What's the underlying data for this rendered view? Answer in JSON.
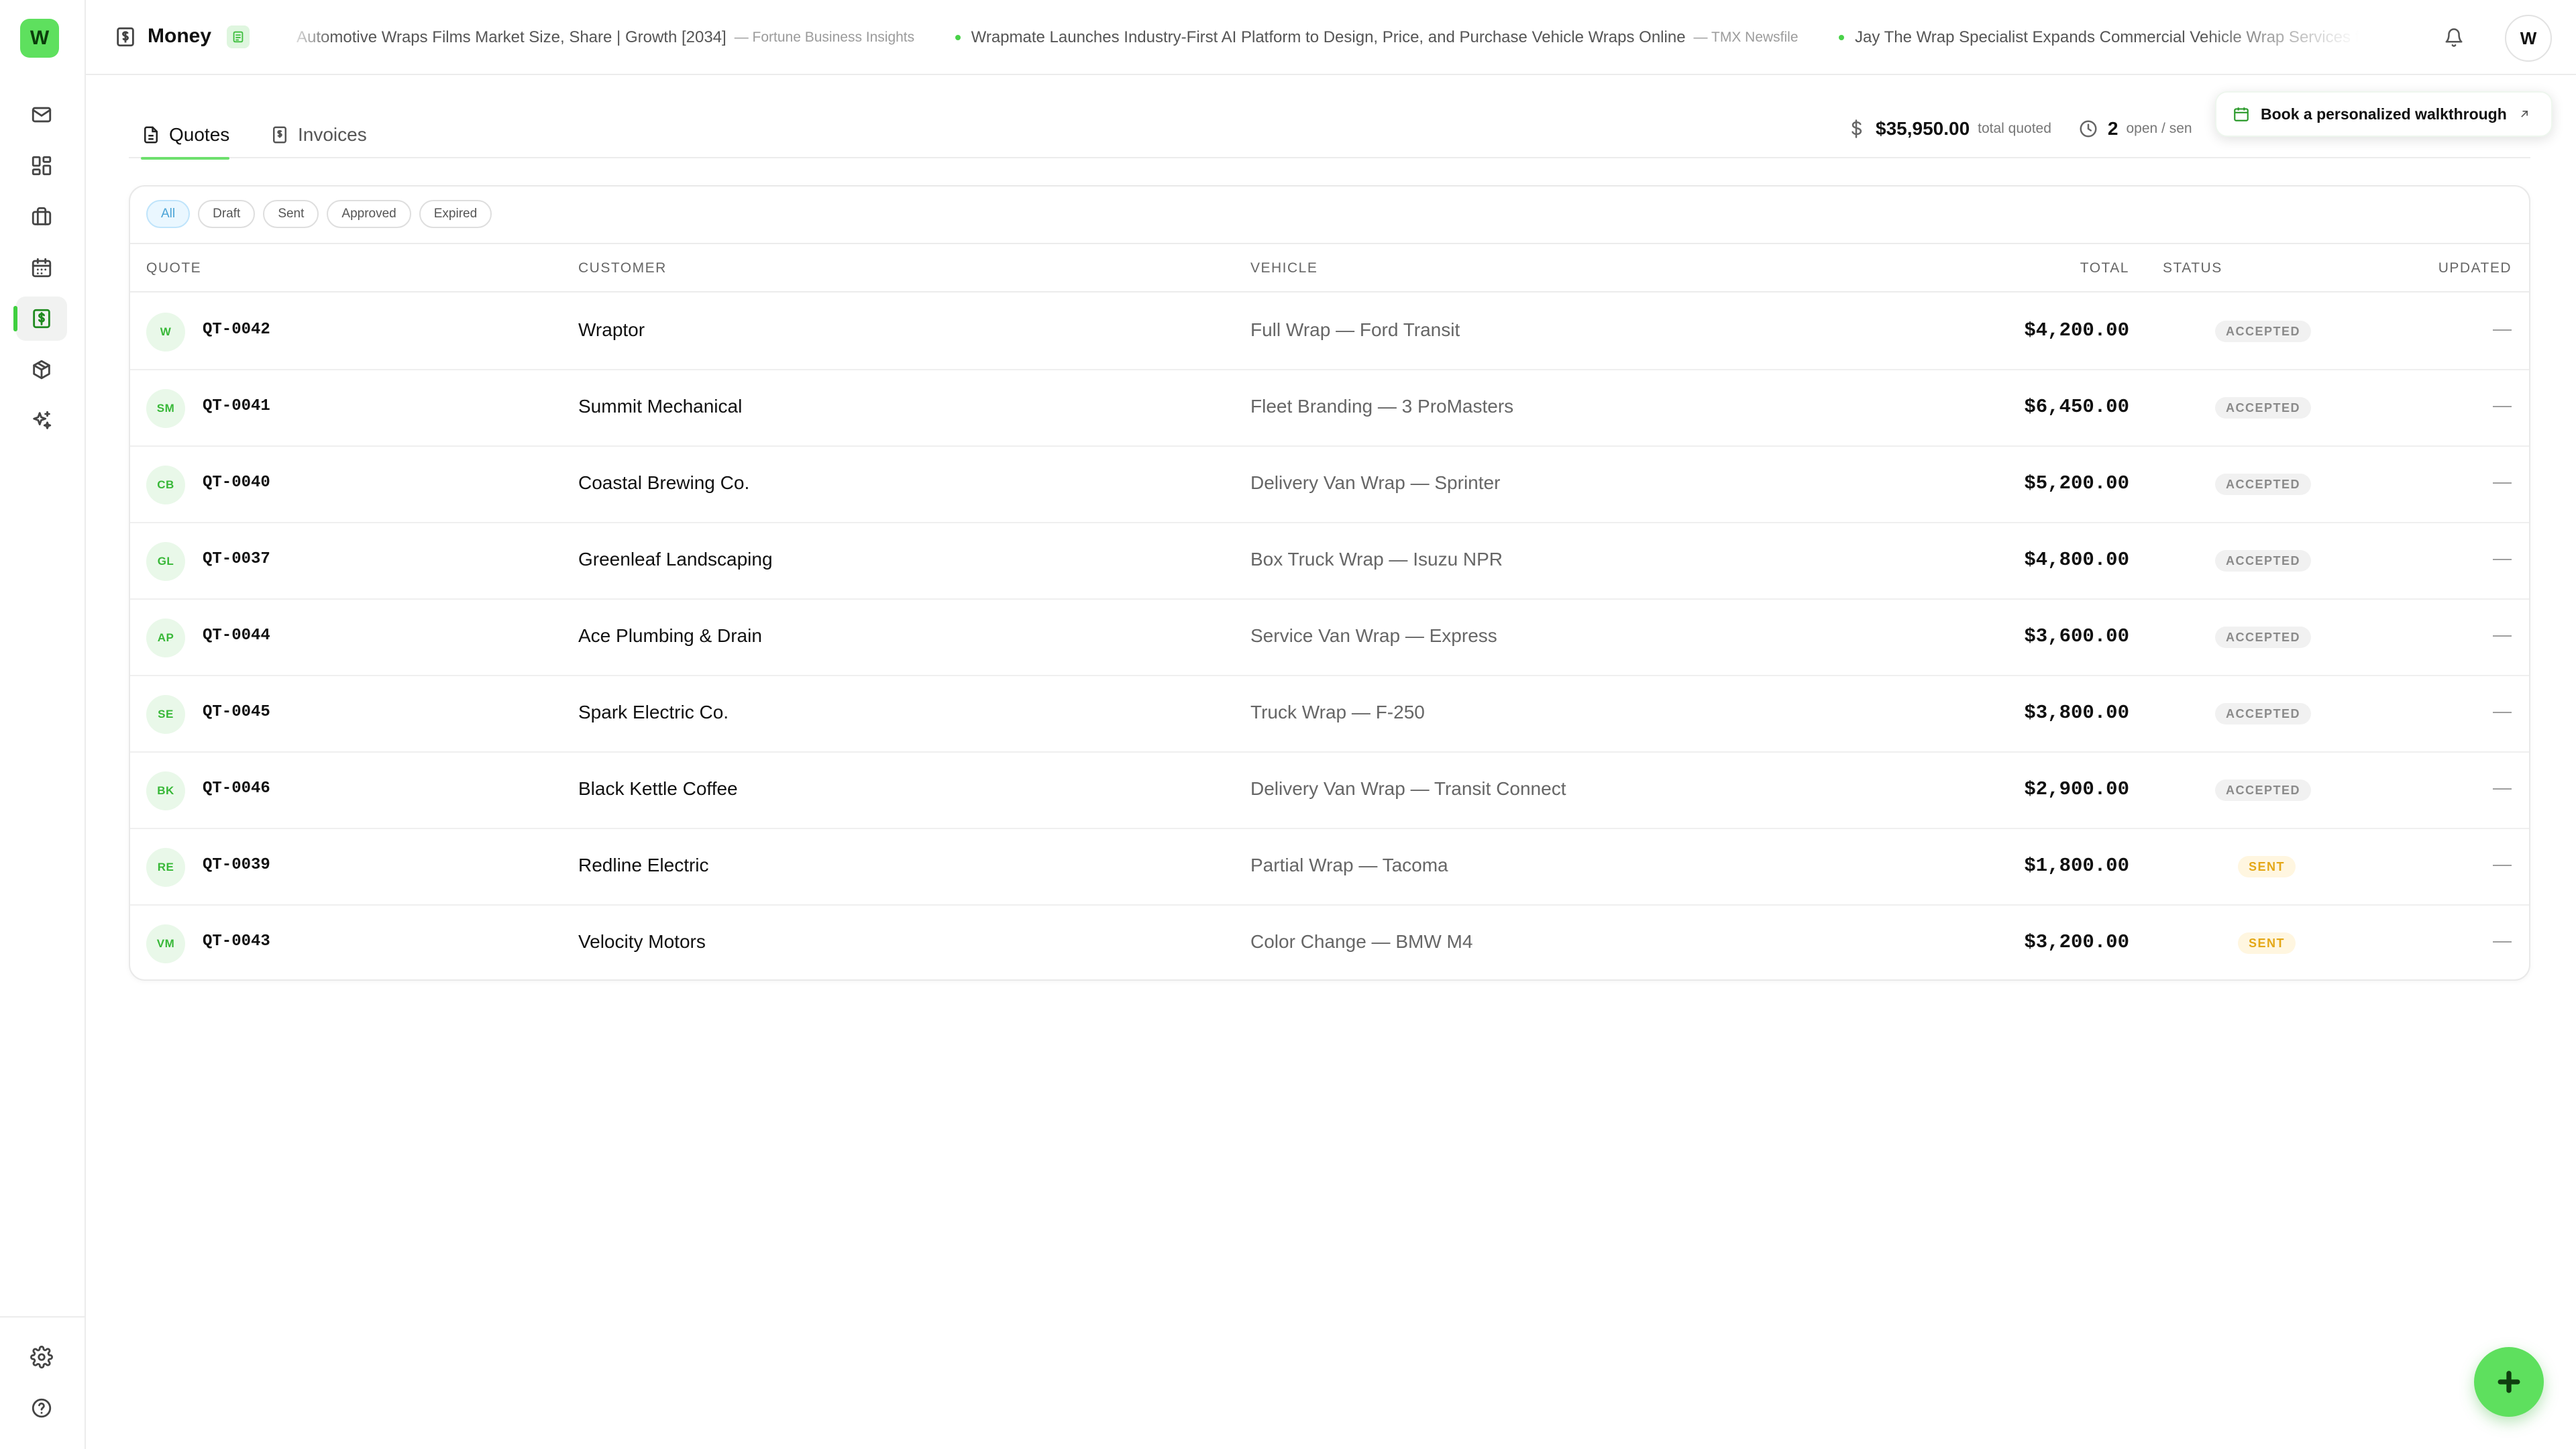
{
  "app": {
    "logo_letter": "W",
    "page_title": "Money",
    "user_initial": "W"
  },
  "sidebar": {
    "items": [
      {
        "name": "inbox",
        "icon": "mail-icon",
        "active": false
      },
      {
        "name": "dashboard",
        "icon": "dashboard-icon",
        "active": false
      },
      {
        "name": "jobs",
        "icon": "briefcase-icon",
        "active": false
      },
      {
        "name": "calendar",
        "icon": "calendar-icon",
        "active": false
      },
      {
        "name": "money",
        "icon": "money-icon",
        "active": true
      },
      {
        "name": "inventory",
        "icon": "package-icon",
        "active": false
      },
      {
        "name": "ai",
        "icon": "sparkles-icon",
        "active": false
      }
    ],
    "bottom": [
      {
        "name": "settings",
        "icon": "gear-icon"
      },
      {
        "name": "help",
        "icon": "help-icon"
      }
    ]
  },
  "news": [
    {
      "title": "Automotive Wraps Films Market Size, Share | Growth [2034]",
      "source": "— Fortune Business Insights"
    },
    {
      "title": "Wrapmate Launches Industry-First AI Platform to Design, Price, and Purchase Vehicle Wraps Online",
      "source": "— TMX Newsfile"
    },
    {
      "title": "Jay The Wrap Specialist Expands Commercial Vehicle Wrap Services for Mo",
      "source": ""
    }
  ],
  "tabs": [
    {
      "label": "Quotes",
      "active": true
    },
    {
      "label": "Invoices",
      "active": false
    }
  ],
  "stats": {
    "total_value": "$35,950.00",
    "total_label": "total quoted",
    "open_value": "2",
    "open_label": "open / sen"
  },
  "walkthrough": {
    "label": "Book a personalized walkthrough"
  },
  "filters": [
    "All",
    "Draft",
    "Sent",
    "Approved",
    "Expired"
  ],
  "table": {
    "columns": {
      "quote": "Quote",
      "customer": "Customer",
      "vehicle": "Vehicle",
      "total": "Total",
      "status": "Status",
      "updated": "Updated"
    },
    "rows": [
      {
        "initials": "W",
        "id": "QT-0042",
        "customer": "Wraptor",
        "vehicle": "Full Wrap — Ford Transit",
        "total": "$4,200.00",
        "status": "Accepted",
        "status_kind": "accepted",
        "updated": "—"
      },
      {
        "initials": "SM",
        "id": "QT-0041",
        "customer": "Summit Mechanical",
        "vehicle": "Fleet Branding — 3 ProMasters",
        "total": "$6,450.00",
        "status": "Accepted",
        "status_kind": "accepted",
        "updated": "—"
      },
      {
        "initials": "CB",
        "id": "QT-0040",
        "customer": "Coastal Brewing Co.",
        "vehicle": "Delivery Van Wrap — Sprinter",
        "total": "$5,200.00",
        "status": "Accepted",
        "status_kind": "accepted",
        "updated": "—"
      },
      {
        "initials": "GL",
        "id": "QT-0037",
        "customer": "Greenleaf Landscaping",
        "vehicle": "Box Truck Wrap — Isuzu NPR",
        "total": "$4,800.00",
        "status": "Accepted",
        "status_kind": "accepted",
        "updated": "—"
      },
      {
        "initials": "AP",
        "id": "QT-0044",
        "customer": "Ace Plumbing & Drain",
        "vehicle": "Service Van Wrap — Express",
        "total": "$3,600.00",
        "status": "Accepted",
        "status_kind": "accepted",
        "updated": "—"
      },
      {
        "initials": "SE",
        "id": "QT-0045",
        "customer": "Spark Electric Co.",
        "vehicle": "Truck Wrap — F-250",
        "total": "$3,800.00",
        "status": "Accepted",
        "status_kind": "accepted",
        "updated": "—"
      },
      {
        "initials": "BK",
        "id": "QT-0046",
        "customer": "Black Kettle Coffee",
        "vehicle": "Delivery Van Wrap — Transit Connect",
        "total": "$2,900.00",
        "status": "Accepted",
        "status_kind": "accepted",
        "updated": "—"
      },
      {
        "initials": "RE",
        "id": "QT-0039",
        "customer": "Redline Electric",
        "vehicle": "Partial Wrap — Tacoma",
        "total": "$1,800.00",
        "status": "Sent",
        "status_kind": "sent",
        "updated": "—"
      },
      {
        "initials": "VM",
        "id": "QT-0043",
        "customer": "Velocity Motors",
        "vehicle": "Color Change — BMW M4",
        "total": "$3,200.00",
        "status": "Sent",
        "status_kind": "sent",
        "updated": "—"
      }
    ]
  },
  "colors": {
    "accent": "#5ee05e",
    "accepted_text": "#8a8a8a",
    "sent_text": "#e4a716",
    "filter_active": "#4aa3d6"
  }
}
